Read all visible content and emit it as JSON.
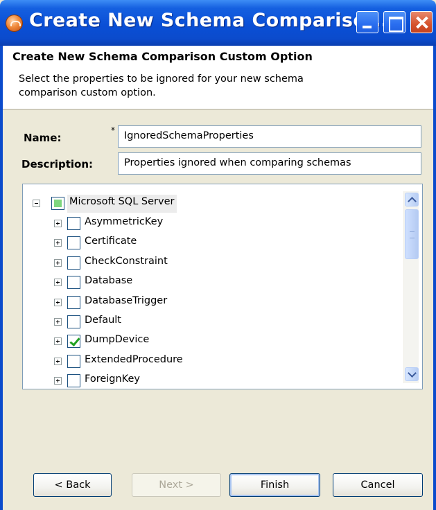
{
  "window": {
    "title": "Create New Schema Compariso...",
    "controls": [
      "minimize-icon",
      "maximize-icon",
      "close-icon"
    ]
  },
  "header": {
    "title": "Create New Schema Comparison Custom Option",
    "description": "Select the properties to be ignored for your new schema comparison custom option."
  },
  "form": {
    "name_label": "Name:",
    "name_required_marker": "*",
    "name_value": "IgnoredSchemaProperties",
    "description_label": "Description:",
    "description_value": "Properties ignored when comparing schemas"
  },
  "tree": {
    "root": {
      "label": "Microsoft SQL Server",
      "expanded": true,
      "check_state": "partial"
    },
    "items": [
      {
        "label": "AsymmetricKey",
        "checked": false
      },
      {
        "label": "Certificate",
        "checked": false
      },
      {
        "label": "CheckConstraint",
        "checked": false
      },
      {
        "label": "Database",
        "checked": false
      },
      {
        "label": "DatabaseTrigger",
        "checked": false
      },
      {
        "label": "Default",
        "checked": false
      },
      {
        "label": "DumpDevice",
        "checked": true
      },
      {
        "label": "ExtendedProcedure",
        "checked": false
      },
      {
        "label": "ForeignKey",
        "checked": false
      }
    ]
  },
  "buttons": {
    "back": "< Back",
    "next": "Next >",
    "finish": "Finish",
    "cancel": "Cancel"
  }
}
